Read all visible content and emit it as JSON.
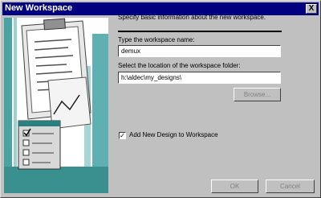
{
  "window": {
    "title": "New Workspace",
    "close_glyph": "X"
  },
  "intro": "Specify basic information about the new workspace.",
  "workspace_name": {
    "label": "Type the workspace name:",
    "value": "demux"
  },
  "location": {
    "label": "Select the location of the workspace folder:",
    "value": "h:\\aldec\\my_designs\\"
  },
  "browse_label": "Browse...",
  "add_design": {
    "label": "Add New Design to Workspace",
    "checked": true,
    "check_glyph": "✓"
  },
  "ok_label": "OK",
  "cancel_label": "Cancel",
  "icons": {
    "wizard_image": "clipboard-checklist-illustration"
  },
  "colors": {
    "title_bar": "#000080",
    "dialog_bg": "#c0c0c0",
    "disabled_text": "#808080"
  }
}
